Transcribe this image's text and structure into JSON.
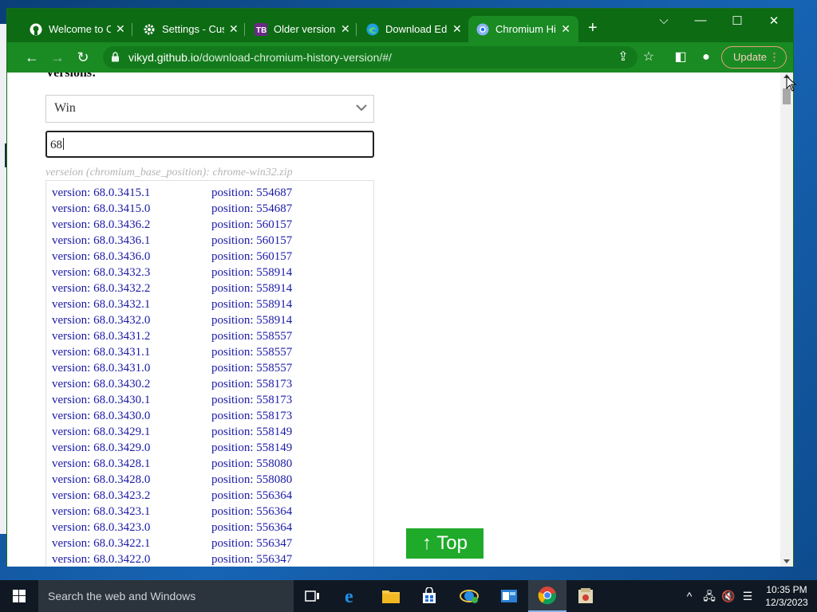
{
  "browser": {
    "tabs": [
      {
        "title": "Welcome to C",
        "icon": "github-icon",
        "active": false
      },
      {
        "title": "Settings - Cus",
        "icon": "gear-icon",
        "active": false
      },
      {
        "title": "Older versions",
        "icon": "tb-icon",
        "active": false
      },
      {
        "title": "Download Ed",
        "icon": "edge-icon",
        "active": false
      },
      {
        "title": "Chromium His",
        "icon": "chrome-icon",
        "active": true
      }
    ],
    "new_tab": "+",
    "window_controls": {
      "tab_search": "⌵",
      "minimize": "—",
      "maximize": "☐",
      "close": "✕"
    },
    "url_host": "vikyd.github.io",
    "url_path": "/download-chromium-history-version/#/",
    "update_label": "Update",
    "theme_color": "#0d6b14"
  },
  "page": {
    "versions_heading": "Versions:",
    "os_select_value": "Win",
    "search_value": "68",
    "hint": "verseion (chromium_base_position): chrome-win32.zip",
    "top_button": "↑ Top",
    "results": [
      {
        "version": "version: 68.0.3415.1",
        "position": "position: 554687"
      },
      {
        "version": "version: 68.0.3415.0",
        "position": "position: 554687"
      },
      {
        "version": "version: 68.0.3436.2",
        "position": "position: 560157"
      },
      {
        "version": "version: 68.0.3436.1",
        "position": "position: 560157"
      },
      {
        "version": "version: 68.0.3436.0",
        "position": "position: 560157"
      },
      {
        "version": "version: 68.0.3432.3",
        "position": "position: 558914"
      },
      {
        "version": "version: 68.0.3432.2",
        "position": "position: 558914"
      },
      {
        "version": "version: 68.0.3432.1",
        "position": "position: 558914"
      },
      {
        "version": "version: 68.0.3432.0",
        "position": "position: 558914"
      },
      {
        "version": "version: 68.0.3431.2",
        "position": "position: 558557"
      },
      {
        "version": "version: 68.0.3431.1",
        "position": "position: 558557"
      },
      {
        "version": "version: 68.0.3431.0",
        "position": "position: 558557"
      },
      {
        "version": "version: 68.0.3430.2",
        "position": "position: 558173"
      },
      {
        "version": "version: 68.0.3430.1",
        "position": "position: 558173"
      },
      {
        "version": "version: 68.0.3430.0",
        "position": "position: 558173"
      },
      {
        "version": "version: 68.0.3429.1",
        "position": "position: 558149"
      },
      {
        "version": "version: 68.0.3429.0",
        "position": "position: 558149"
      },
      {
        "version": "version: 68.0.3428.1",
        "position": "position: 558080"
      },
      {
        "version": "version: 68.0.3428.0",
        "position": "position: 558080"
      },
      {
        "version": "version: 68.0.3423.2",
        "position": "position: 556364"
      },
      {
        "version": "version: 68.0.3423.1",
        "position": "position: 556364"
      },
      {
        "version": "version: 68.0.3423.0",
        "position": "position: 556364"
      },
      {
        "version": "version: 68.0.3422.1",
        "position": "position: 556347"
      },
      {
        "version": "version: 68.0.3422.0",
        "position": "position: 556347"
      }
    ]
  },
  "taskbar": {
    "search_placeholder": "Search the web and Windows",
    "apps": [
      "task-view-icon",
      "edge-legacy-icon",
      "file-explorer-icon",
      "store-icon",
      "ie-update-icon",
      "outlook-icon",
      "chrome-icon",
      "installer-icon"
    ],
    "time": "10:35 PM",
    "date": "12/3/2023"
  }
}
